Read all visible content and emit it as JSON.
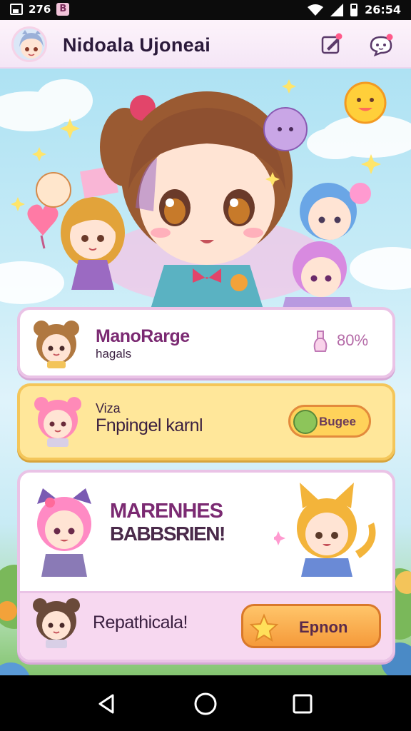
{
  "status_bar": {
    "notification_count": "276",
    "time": "26:54"
  },
  "header": {
    "title": "Nidoala Ujoneai"
  },
  "cards": [
    {
      "title": "ManoRarge",
      "subtitle": "hagals",
      "percent": "80%"
    },
    {
      "line1": "Viza",
      "line2": "Fnpingel karnl",
      "button_label": "Bugee"
    },
    {
      "headline_line1": "MARENHES",
      "headline_line2": "BABBSRIEN!",
      "footer_text": "Repathicala!",
      "button_label": "Epnon"
    }
  ],
  "icons": {
    "header": [
      "edit-icon",
      "chat-icon"
    ],
    "nav": [
      "back-icon",
      "home-icon",
      "recents-icon"
    ]
  },
  "colors": {
    "accent": "#7b2a72",
    "card_yellow": "#ffe79a",
    "button_orange": "#f59a3a"
  }
}
